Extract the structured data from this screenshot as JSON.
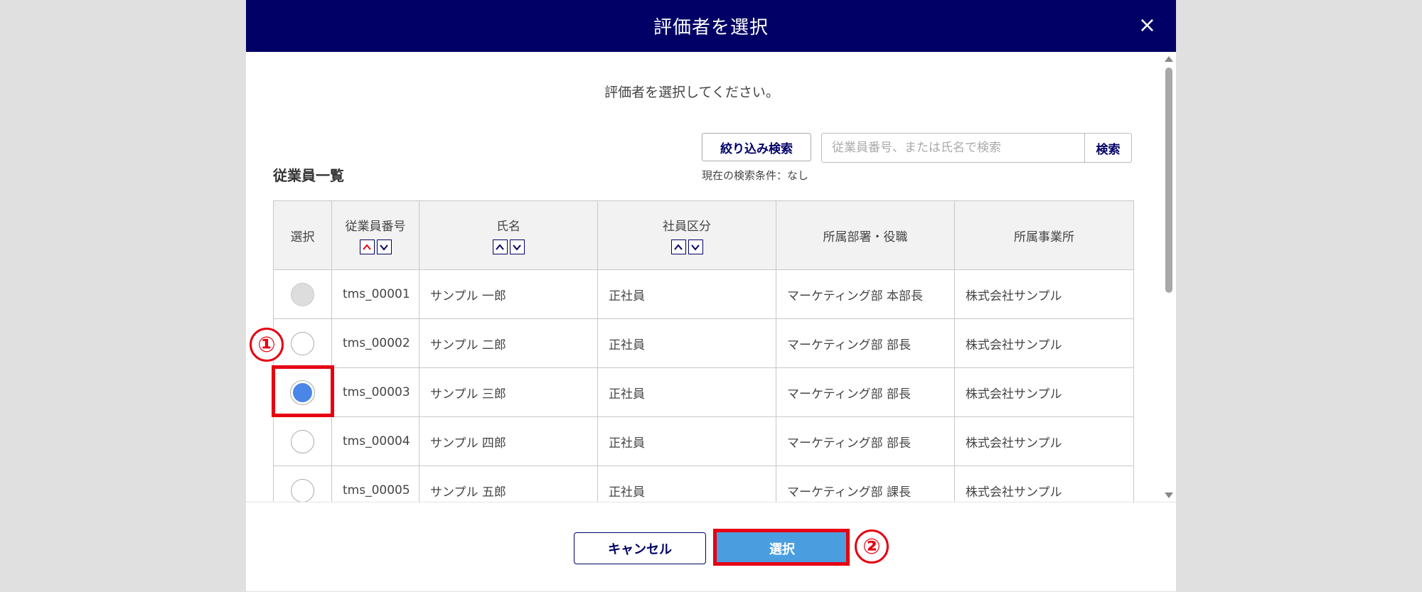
{
  "dialog": {
    "title": "評価者を選択",
    "close_glyph": "×"
  },
  "instruction": "評価者を選択してください。",
  "list_title": "従業員一覧",
  "filter": {
    "button_label": "絞り込み検索",
    "search_placeholder": "従業員番号、または氏名で検索",
    "search_value": "",
    "search_button_label": "検索",
    "current_condition": "現在の検索条件：なし"
  },
  "table": {
    "headers": {
      "select": "選択",
      "emp_no": "従業員番号",
      "name": "氏名",
      "type": "社員区分",
      "dept": "所属部署・役職",
      "office": "所属事業所"
    },
    "rows": [
      {
        "emp_no": "tms_00001",
        "name": "サンプル 一郎",
        "type": "正社員",
        "dept": "マーケティング部 本部長",
        "office": "株式会社サンプル",
        "state": "disabled"
      },
      {
        "emp_no": "tms_00002",
        "name": "サンプル 二郎",
        "type": "正社員",
        "dept": "マーケティング部 部長",
        "office": "株式会社サンプル",
        "state": "unchecked"
      },
      {
        "emp_no": "tms_00003",
        "name": "サンプル 三郎",
        "type": "正社員",
        "dept": "マーケティング部 部長",
        "office": "株式会社サンプル",
        "state": "checked"
      },
      {
        "emp_no": "tms_00004",
        "name": "サンプル 四郎",
        "type": "正社員",
        "dept": "マーケティング部 部長",
        "office": "株式会社サンプル",
        "state": "unchecked"
      },
      {
        "emp_no": "tms_00005",
        "name": "サンプル 五郎",
        "type": "正社員",
        "dept": "マーケティング部 課長",
        "office": "株式会社サンプル",
        "state": "unchecked"
      }
    ]
  },
  "footer": {
    "cancel_label": "キャンセル",
    "select_label": "選択"
  },
  "annotations": {
    "step1": "①",
    "step2": "②"
  },
  "colors": {
    "header_bg": "#000066",
    "primary_button": "#4a9ee0",
    "radio_checked": "#4a86e8",
    "annotation_red": "#e60012",
    "sort_active": "#e60012"
  },
  "icons": {
    "close": "close-icon",
    "sort_up": "chevron-up-icon",
    "sort_down": "chevron-down-icon"
  }
}
